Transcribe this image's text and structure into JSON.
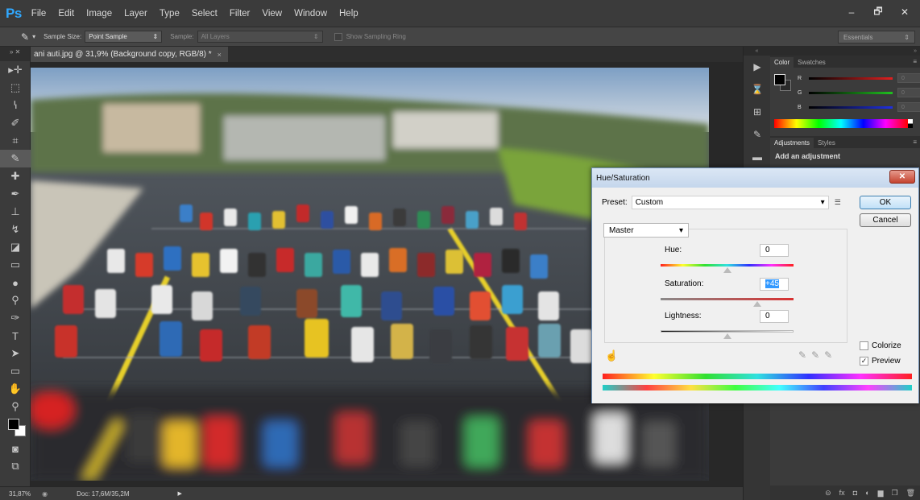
{
  "menubar": {
    "logo": "Ps",
    "items": [
      "File",
      "Edit",
      "Image",
      "Layer",
      "Type",
      "Select",
      "Filter",
      "View",
      "Window",
      "Help"
    ],
    "window_buttons": [
      "–",
      "🗗",
      "✕"
    ]
  },
  "options_bar": {
    "sample_size_label": "Sample Size:",
    "sample_size_value": "Point Sample",
    "sample_label": "Sample:",
    "sample_value": "All Layers",
    "show_sampling_ring_label": "Show Sampling Ring",
    "workspace": "Essentials"
  },
  "document": {
    "tab_title": "ani auti.jpg @ 31,9% (Background copy, RGB/8) *",
    "tab_close": "×"
  },
  "statusbar": {
    "zoom": "31,87%",
    "doc_size": "Doc: 17,6M/35,2M"
  },
  "panels": {
    "color_tabs": [
      "Color",
      "Swatches"
    ],
    "rgb_letters": [
      "R",
      "G",
      "B"
    ],
    "rgb_values": [
      "0",
      "0",
      "0"
    ],
    "adjust_tabs": [
      "Adjustments",
      "Styles"
    ],
    "adjust_title": "Add an adjustment"
  },
  "dialog": {
    "title": "Hue/Saturation",
    "close": "✕",
    "preset_label": "Preset:",
    "preset_value": "Custom",
    "ok": "OK",
    "cancel": "Cancel",
    "channel": "Master",
    "hue_label": "Hue:",
    "hue_value": "0",
    "saturation_label": "Saturation:",
    "saturation_value": "+45",
    "lightness_label": "Lightness:",
    "lightness_value": "0",
    "colorize_label": "Colorize",
    "colorize_checked": false,
    "preview_label": "Preview",
    "preview_checked": true,
    "preview_mark": "✓"
  }
}
